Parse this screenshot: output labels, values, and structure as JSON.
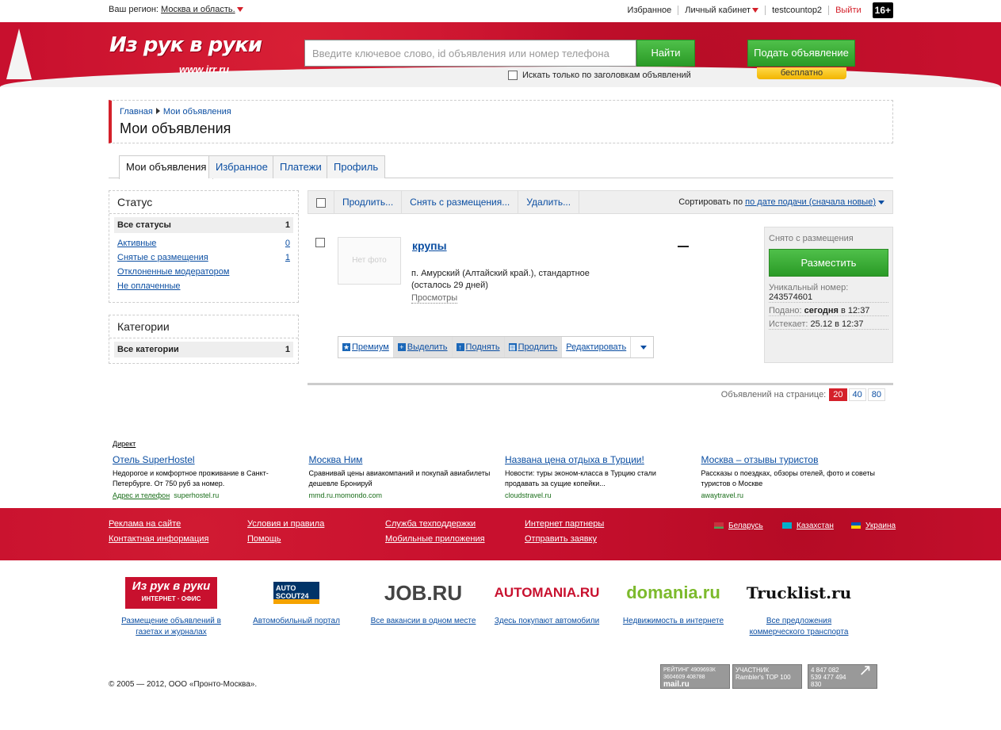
{
  "topbar": {
    "region_label": "Ваш регион:",
    "region_value": "Москва и область.",
    "favorites": "Избранное",
    "cabinet": "Личный кабинет",
    "user": "testcountop2",
    "logout": "Выйти",
    "age": "16+"
  },
  "header": {
    "logo": "Из рук в руки",
    "logo_url": "www.irr.ru",
    "search_placeholder": "Введите ключевое слово, id объявления или номер телефона",
    "find": "Найти",
    "title_only": "Искать только по заголовкам объявлений",
    "post": "Подать объявление",
    "free": "бесплатно"
  },
  "breadcrumb": {
    "home": "Главная",
    "current": "Мои объявления",
    "title": "Мои объявления"
  },
  "tabs": [
    {
      "label": "Мои объявления"
    },
    {
      "label": "Избранное"
    },
    {
      "label": "Платежи"
    },
    {
      "label": "Профиль"
    }
  ],
  "status_panel": {
    "title": "Статус",
    "items": [
      {
        "label": "Все статусы",
        "count": "1"
      },
      {
        "label": "Активные",
        "count": "0"
      },
      {
        "label": "Снятые с размещения",
        "count": "1"
      },
      {
        "label": "Отклоненные модератором",
        "count": ""
      },
      {
        "label": "Не оплаченные",
        "count": ""
      }
    ]
  },
  "category_panel": {
    "title": "Категории",
    "items": [
      {
        "label": "Все категории",
        "count": "1"
      }
    ]
  },
  "actions": {
    "extend": "Продлить...",
    "remove": "Снять с размещения...",
    "delete": "Удалить...",
    "sort_label": "Сортировать по",
    "sort_value": "по дате подачи (сначала новые)"
  },
  "ad": {
    "no_photo": "Нет фото",
    "title": "крупы",
    "location": "п. Амурский (Алтайский край.), стандартное",
    "remaining": "(осталось 29 дней)",
    "views": "Просмотры",
    "tools": {
      "premium": "Премиум",
      "highlight": "Выделить",
      "raise": "Поднять",
      "extend": "Продлить",
      "edit": "Редактировать"
    },
    "status": "Снято с размещения",
    "place": "Разместить",
    "unique_label": "Уникальный номер:",
    "unique": "243574601",
    "submitted_label": "Подано:",
    "submitted_day": "сегодня",
    "submitted_time": "в 12:37",
    "expires_label": "Истекает:",
    "expires": "25.12 в 12:37"
  },
  "pager": {
    "label": "Объявлений на странице:",
    "options": [
      "20",
      "40",
      "80"
    ],
    "current": "20"
  },
  "direct": {
    "label": "Директ",
    "ads": [
      {
        "title": "Отель SuperHostel",
        "text": "Недорогое и комфортное проживание в Санкт-Петербурге. От 750 руб за номер.",
        "extra": "Адрес и телефон",
        "url": "superhostel.ru"
      },
      {
        "title": "Москва Ним",
        "text": "Сравнивай цены авиакомпаний и покупай авиабилеты дешевле Бронируй",
        "extra": "",
        "url": "mmd.ru.momondo.com"
      },
      {
        "title": "Названа цена отдыха в Турции!",
        "text": "Новости: туры эконом-класса в Турцию стали продавать за сущие копейки...",
        "extra": "",
        "url": "cloudstravel.ru"
      },
      {
        "title": "Москва – отзывы туристов",
        "text": "Рассказы о поездках, обзоры отелей, фото и советы туристов о Москве",
        "extra": "",
        "url": "awaytravel.ru"
      }
    ]
  },
  "footer": {
    "links": [
      "Реклама на сайте",
      "Контактная информация",
      "Условия и правила",
      "Помощь",
      "Служба техподдержки",
      "Мобильные приложения",
      "Интернет партнеры",
      "Отправить заявку"
    ],
    "countries": [
      "Беларусь",
      "Казахстан",
      "Украина"
    ]
  },
  "partners": [
    {
      "logo": "Из рук в руки",
      "sub": "ИНТЕРНЕТ · ОФИС",
      "caption": "Размещение объявлений в газетах и журналах"
    },
    {
      "logo": "AUTO SCOUT24",
      "sub": "",
      "caption": "Автомобильный портал"
    },
    {
      "logo": "JOB.RU",
      "sub": "",
      "caption": "Все вакансии в одном месте"
    },
    {
      "logo": "AUTOMANIA.RU",
      "sub": "",
      "caption": "Здесь покупают автомобили"
    },
    {
      "logo": "domania.ru",
      "sub": "",
      "caption": "Недвижимость в интернете"
    },
    {
      "logo": "Trucklist.ru",
      "sub": "",
      "caption": "Все предложения коммерческого транспорта"
    }
  ],
  "copyright": "© 2005 — 2012, ООО «Пронто-Москва».",
  "counters": {
    "mail": "РЕЙТИНГ 4909693К 3604609 408788",
    "mail_logo": "mail.ru",
    "rambler": "УЧАСТНИК Rambler's TOP 100",
    "liveinternet": "4 847 082 539 477 494 830"
  }
}
